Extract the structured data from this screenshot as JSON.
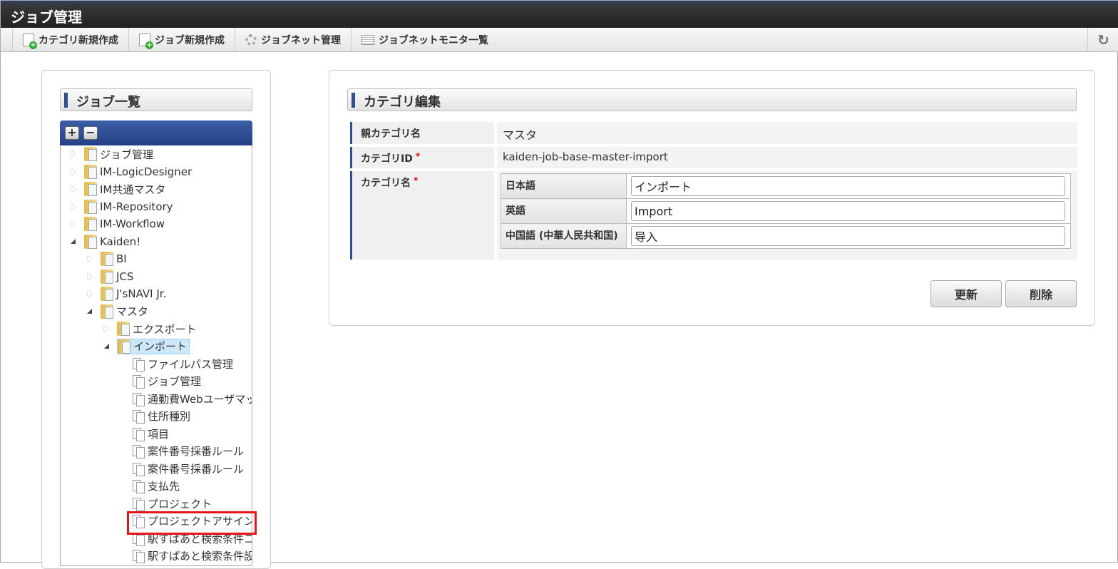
{
  "app_title": "ジョブ管理",
  "toolbar": {
    "items": [
      {
        "label": "カテゴリ新規作成",
        "icon": "new-category-icon"
      },
      {
        "label": "ジョブ新規作成",
        "icon": "new-job-icon"
      },
      {
        "label": "ジョブネット管理",
        "icon": "gear-icon"
      },
      {
        "label": "ジョブネットモニタ一覧",
        "icon": "list-icon"
      }
    ],
    "refresh_icon": "refresh-icon"
  },
  "left": {
    "title": "ジョブ一覧",
    "expand_label": "+",
    "collapse_label": "−",
    "tree": [
      {
        "label": "ジョブ管理",
        "level": 0,
        "type": "folder",
        "state": "closed"
      },
      {
        "label": "IM-LogicDesigner",
        "level": 0,
        "type": "folder",
        "state": "closed"
      },
      {
        "label": "IM共通マスタ",
        "level": 0,
        "type": "folder",
        "state": "closed"
      },
      {
        "label": "IM-Repository",
        "level": 0,
        "type": "folder",
        "state": "closed"
      },
      {
        "label": "IM-Workflow",
        "level": 0,
        "type": "folder",
        "state": "closed"
      },
      {
        "label": "Kaiden!",
        "level": 0,
        "type": "folder",
        "state": "open"
      },
      {
        "label": "BI",
        "level": 1,
        "type": "folder",
        "state": "closed"
      },
      {
        "label": "JCS",
        "level": 1,
        "type": "folder",
        "state": "closed"
      },
      {
        "label": "J'sNAVI Jr.",
        "level": 1,
        "type": "folder",
        "state": "closed"
      },
      {
        "label": "マスタ",
        "level": 1,
        "type": "folder",
        "state": "open"
      },
      {
        "label": "エクスポート",
        "level": 2,
        "type": "folder",
        "state": "closed"
      },
      {
        "label": "インポート",
        "level": 2,
        "type": "folder",
        "state": "open",
        "selected": true
      },
      {
        "label": "ファイルパス管理",
        "level": 3,
        "type": "file"
      },
      {
        "label": "ジョブ管理",
        "level": 3,
        "type": "file"
      },
      {
        "label": "通勤費Webユーザマッ",
        "level": 3,
        "type": "file"
      },
      {
        "label": "住所種別",
        "level": 3,
        "type": "file"
      },
      {
        "label": "項目",
        "level": 3,
        "type": "file"
      },
      {
        "label": "案件番号採番ルール",
        "level": 3,
        "type": "file"
      },
      {
        "label": "案件番号採番ルール",
        "level": 3,
        "type": "file"
      },
      {
        "label": "支払先",
        "level": 3,
        "type": "file"
      },
      {
        "label": "プロジェクト",
        "level": 3,
        "type": "file"
      },
      {
        "label": "プロジェクトアサイン",
        "level": 3,
        "type": "file",
        "highlighted": true
      },
      {
        "label": "駅すぱあと検索条件コ",
        "level": 3,
        "type": "file"
      },
      {
        "label": "駅すぱあと検索条件設",
        "level": 3,
        "type": "file"
      }
    ]
  },
  "right": {
    "title": "カテゴリ編集",
    "parent_label": "親カテゴリ名",
    "parent_value": "マスタ",
    "id_label": "カテゴリID",
    "id_value": "kaiden-job-base-master-import",
    "name_label": "カテゴリ名",
    "required_mark": "*",
    "names": [
      {
        "lang": "日本語",
        "value": "インポート"
      },
      {
        "lang": "英語",
        "value": "Import"
      },
      {
        "lang": "中国語 (中華人民共和国)",
        "value": "导入"
      }
    ],
    "update_label": "更新",
    "delete_label": "削除"
  }
}
